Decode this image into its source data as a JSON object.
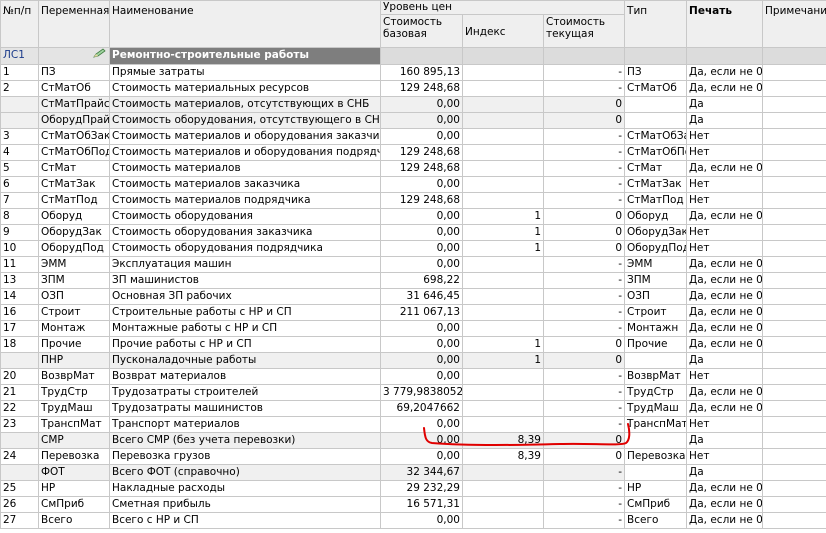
{
  "headers": {
    "num": "№п/п",
    "variable": "Переменная",
    "name": "Наименование",
    "price_level": "Уровень цен",
    "cost_base": "Стоимость базовая",
    "index": "Индекс",
    "cost_current": "Стоимость текущая",
    "type": "Тип",
    "print": "Печать",
    "note": "Примечание"
  },
  "section": {
    "code": "ЛС1",
    "icon": "pencil-icon",
    "title": "Ремонтно-строительные работы"
  },
  "colors": {
    "section_title_bg": "#7e7e7e",
    "highlight_stroke": "#e00000",
    "alt_row_bg": "#f0f0f0"
  },
  "rows": [
    {
      "num": "1",
      "var": "ПЗ",
      "name": "Прямые затраты",
      "base": "160 895,13",
      "index": "",
      "current": "-",
      "type": "ПЗ",
      "print": "Да, если не 0",
      "alt": false
    },
    {
      "num": "2",
      "var": "СтМатОб",
      "name": "Стоимость материальных ресурсов",
      "base": "129 248,68",
      "index": "",
      "current": "-",
      "type": "СтМатОб",
      "print": "Да, если не 0",
      "alt": false
    },
    {
      "num": "",
      "var": "СтМатПрайс",
      "name": "Стоимость материалов, отсутствующих в СНБ",
      "base": "0,00",
      "index": "",
      "current": "0",
      "type": "",
      "print": "Да",
      "alt": true
    },
    {
      "num": "",
      "var": "ОборудПрайс",
      "name": "Стоимость оборудования, отсутствующего в СНБ",
      "base": "0,00",
      "index": "",
      "current": "0",
      "type": "",
      "print": "Да",
      "alt": true
    },
    {
      "num": "3",
      "var": "СтМатОбЗак",
      "name": "Стоимость материалов и оборудования заказчика",
      "base": "0,00",
      "index": "",
      "current": "-",
      "type": "СтМатОбЗак",
      "print": "Нет",
      "alt": false
    },
    {
      "num": "4",
      "var": "СтМатОбПод",
      "name": "Стоимость материалов и оборудования подрядчика",
      "base": "129 248,68",
      "index": "",
      "current": "-",
      "type": "СтМатОбПод",
      "print": "Нет",
      "alt": false
    },
    {
      "num": "5",
      "var": "СтМат",
      "name": "Стоимость материалов",
      "base": "129 248,68",
      "index": "",
      "current": "-",
      "type": "СтМат",
      "print": "Да, если не 0",
      "alt": false
    },
    {
      "num": "6",
      "var": "СтМатЗак",
      "name": "Стоимость материалов заказчика",
      "base": "0,00",
      "index": "",
      "current": "-",
      "type": "СтМатЗак",
      "print": "Нет",
      "alt": false
    },
    {
      "num": "7",
      "var": "СтМатПод",
      "name": "Стоимость материалов подрядчика",
      "base": "129 248,68",
      "index": "",
      "current": "-",
      "type": "СтМатПод",
      "print": "Нет",
      "alt": false
    },
    {
      "num": "8",
      "var": "Оборуд",
      "name": "Стоимость оборудования",
      "base": "0,00",
      "index": "1",
      "current": "0",
      "type": "Оборуд",
      "print": "Да, если не 0",
      "alt": false
    },
    {
      "num": "9",
      "var": "ОборудЗак",
      "name": "Стоимость оборудования заказчика",
      "base": "0,00",
      "index": "1",
      "current": "0",
      "type": "ОборудЗак",
      "print": "Нет",
      "alt": false
    },
    {
      "num": "10",
      "var": "ОборудПод",
      "name": "Стоимость оборудования подрядчика",
      "base": "0,00",
      "index": "1",
      "current": "0",
      "type": "ОборудПод",
      "print": "Нет",
      "alt": false
    },
    {
      "num": "11",
      "var": "ЭММ",
      "name": "Эксплуатация машин",
      "base": "0,00",
      "index": "",
      "current": "-",
      "type": "ЭММ",
      "print": "Да, если не 0",
      "alt": false
    },
    {
      "num": "13",
      "var": "ЗПМ",
      "name": "ЗП машинистов",
      "base": "698,22",
      "index": "",
      "current": "-",
      "type": "ЗПМ",
      "print": "Да, если не 0",
      "alt": false
    },
    {
      "num": "14",
      "var": "ОЗП",
      "name": "Основная ЗП рабочих",
      "base": "31 646,45",
      "index": "",
      "current": "-",
      "type": "ОЗП",
      "print": "Да, если не 0",
      "alt": false
    },
    {
      "num": "16",
      "var": "Строит",
      "name": "Строительные работы с НР и СП",
      "base": "211 067,13",
      "index": "",
      "current": "-",
      "type": "Строит",
      "print": "Да, если не 0",
      "alt": false
    },
    {
      "num": "17",
      "var": "Монтаж",
      "name": "Монтажные работы с НР и СП",
      "base": "0,00",
      "index": "",
      "current": "-",
      "type": "Монтажн",
      "print": "Да, если не 0",
      "alt": false
    },
    {
      "num": "18",
      "var": "Прочие",
      "name": "Прочие работы с НР и СП",
      "base": "0,00",
      "index": "1",
      "current": "0",
      "type": "Прочие",
      "print": "Да, если не 0",
      "alt": false
    },
    {
      "num": "",
      "var": "ПНР",
      "name": "Пусконаладочные работы",
      "base": "0,00",
      "index": "1",
      "current": "0",
      "type": "",
      "print": "Да",
      "alt": true
    },
    {
      "num": "20",
      "var": "ВозврМат",
      "name": "Возврат материалов",
      "base": "0,00",
      "index": "",
      "current": "-",
      "type": "ВозврМат",
      "print": "Нет",
      "alt": false
    },
    {
      "num": "21",
      "var": "ТрудСтр",
      "name": "Трудозатраты строителей",
      "base": "3 779,9838052",
      "index": "",
      "current": "-",
      "type": "ТрудСтр",
      "print": "Да, если не 0",
      "alt": false
    },
    {
      "num": "22",
      "var": "ТрудМаш",
      "name": "Трудозатраты машинистов",
      "base": "69,2047662",
      "index": "",
      "current": "-",
      "type": "ТрудМаш",
      "print": "Да, если не 0",
      "alt": false
    },
    {
      "num": "23",
      "var": "ТранспМат",
      "name": "Транспорт материалов",
      "base": "0,00",
      "index": "",
      "current": "-",
      "type": "ТранспМат",
      "print": "Нет",
      "alt": false
    },
    {
      "num": "",
      "var": "СМР",
      "name": "Всего СМР (без учета перевозки)",
      "base": "0,00",
      "index": "8,39",
      "current": "0",
      "type": "",
      "print": "Да",
      "alt": true
    },
    {
      "num": "24",
      "var": "Перевозка",
      "name": "Перевозка грузов",
      "base": "0,00",
      "index": "8,39",
      "current": "0",
      "type": "Перевозка",
      "print": "Нет",
      "alt": false
    },
    {
      "num": "",
      "var": "ФОТ",
      "name": "Всего ФОТ (справочно)",
      "base": "32 344,67",
      "index": "",
      "current": "-",
      "type": "",
      "print": "Да",
      "alt": true
    },
    {
      "num": "25",
      "var": "НР",
      "name": "Накладные расходы",
      "base": "29 232,29",
      "index": "",
      "current": "-",
      "type": "НР",
      "print": "Да, если не 0",
      "alt": false
    },
    {
      "num": "26",
      "var": "СмПриб",
      "name": "Сметная прибыль",
      "base": "16 571,31",
      "index": "",
      "current": "-",
      "type": "СмПриб",
      "print": "Да, если не 0",
      "alt": false
    },
    {
      "num": "27",
      "var": "Всего",
      "name": "Всего с НР и СП",
      "base": "0,00",
      "index": "",
      "current": "-",
      "type": "Всего",
      "print": "Да, если не 0",
      "alt": false
    }
  ]
}
